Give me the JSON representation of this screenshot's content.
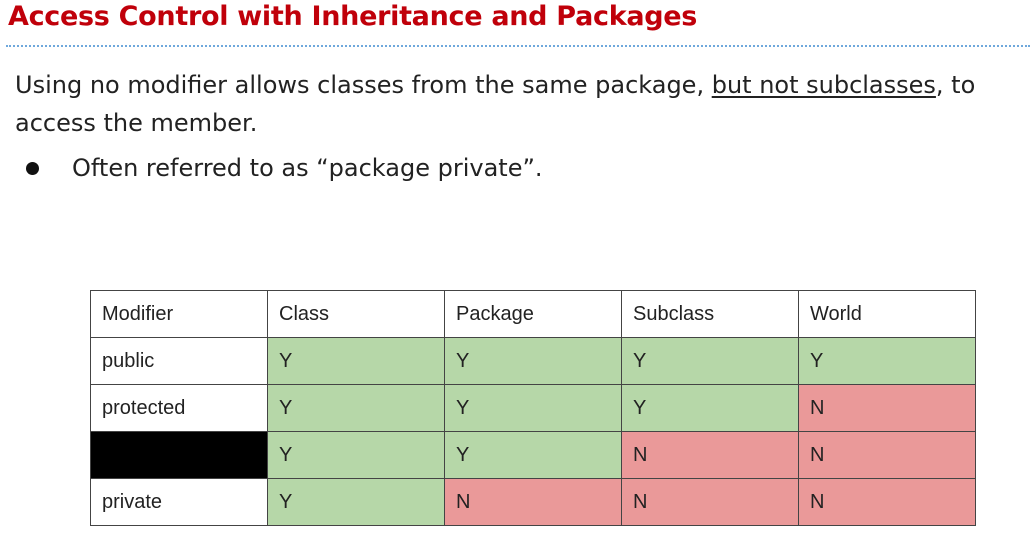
{
  "title": "Access Control with Inheritance and Packages",
  "paragraph": {
    "before": "Using no modifier allows classes from the same package, ",
    "underlined": "but not subclasses",
    "after": ", to access the member."
  },
  "bullet": "Often referred to as “package private”.",
  "table": {
    "headers": [
      "Modifier",
      "Class",
      "Package",
      "Subclass",
      "World"
    ],
    "rows": [
      {
        "modifier": "public",
        "cells": [
          "Y",
          "Y",
          "Y",
          "Y"
        ]
      },
      {
        "modifier": "protected",
        "cells": [
          "Y",
          "Y",
          "Y",
          "N"
        ]
      },
      {
        "modifier": "",
        "cells": [
          "Y",
          "Y",
          "N",
          "N"
        ]
      },
      {
        "modifier": "private",
        "cells": [
          "Y",
          "N",
          "N",
          "N"
        ]
      }
    ]
  },
  "colors": {
    "title": "#c0000a",
    "yes_cell": "#b6d7a8",
    "no_cell": "#ea9999",
    "redacted_cell": "#000000"
  }
}
